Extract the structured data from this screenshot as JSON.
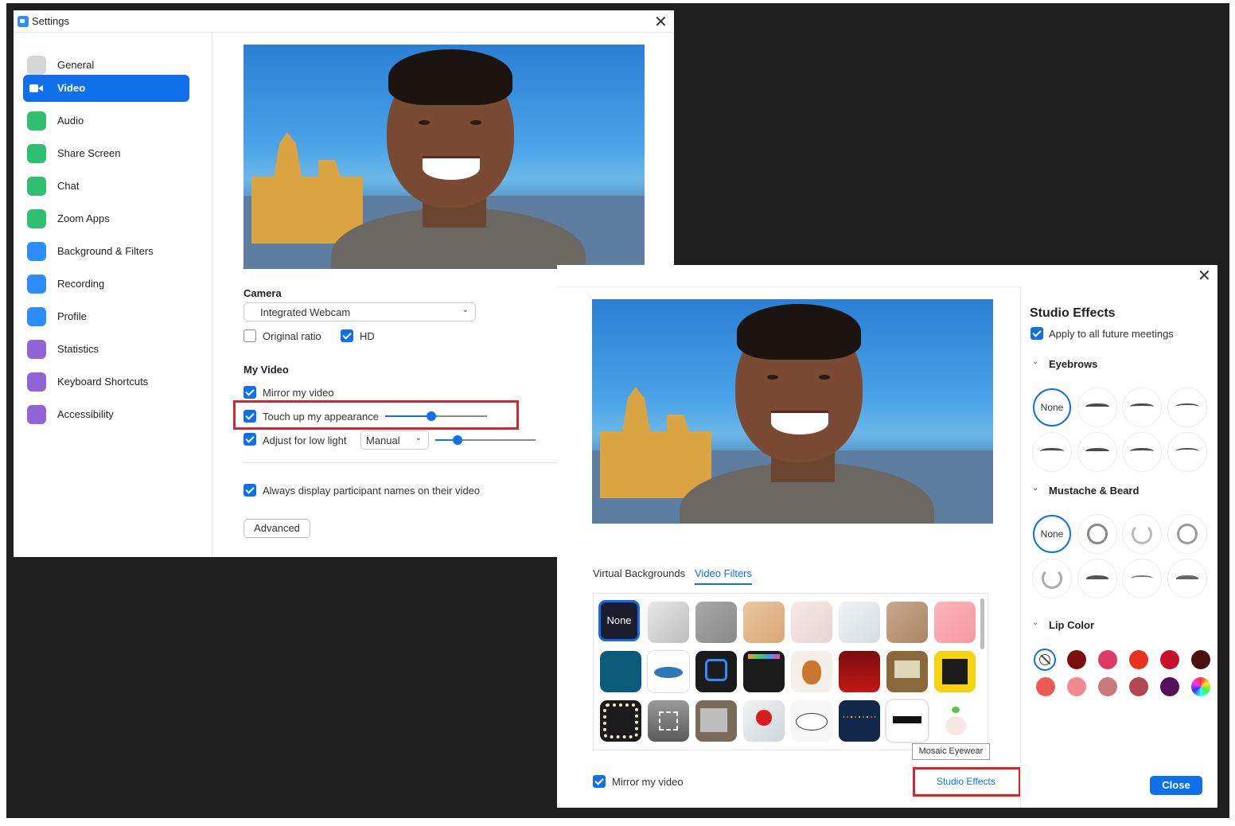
{
  "settings_window": {
    "title": "Settings",
    "close_glyph": "✕",
    "sidebar": [
      {
        "label": "General",
        "icon": "gear-icon",
        "color": "#b0b0b0"
      },
      {
        "label": "Video",
        "icon": "video-camera-icon",
        "color": "#ffffff",
        "active": true
      },
      {
        "label": "Audio",
        "icon": "headphones-icon",
        "color": "#2fbf71"
      },
      {
        "label": "Share Screen",
        "icon": "share-screen-icon",
        "color": "#2fbf71"
      },
      {
        "label": "Chat",
        "icon": "chat-icon",
        "color": "#2fbf71"
      },
      {
        "label": "Zoom Apps",
        "icon": "apps-icon",
        "color": "#2fbf71"
      },
      {
        "label": "Background & Filters",
        "icon": "background-icon",
        "color": "#2d8cff"
      },
      {
        "label": "Recording",
        "icon": "recording-icon",
        "color": "#2d8cff"
      },
      {
        "label": "Profile",
        "icon": "profile-icon",
        "color": "#2d8cff"
      },
      {
        "label": "Statistics",
        "icon": "statistics-icon",
        "color": "#8f65d8"
      },
      {
        "label": "Keyboard Shortcuts",
        "icon": "keyboard-icon",
        "color": "#8f65d8"
      },
      {
        "label": "Accessibility",
        "icon": "accessibility-icon",
        "color": "#8f65d8"
      }
    ],
    "camera": {
      "heading": "Camera",
      "selected": "Integrated Webcam",
      "original_ratio": "Original ratio",
      "original_ratio_checked": false,
      "hd": "HD",
      "hd_checked": true
    },
    "my_video": {
      "heading": "My Video",
      "mirror": "Mirror my video",
      "mirror_checked": true,
      "touch_up": "Touch up my appearance",
      "touch_up_checked": true,
      "touch_up_level": 0.45,
      "low_light": "Adjust for low light",
      "low_light_checked": true,
      "low_light_mode": "Manual",
      "low_light_level": 0.22,
      "participant_names": "Always display participant names on their video",
      "participant_names_checked": true,
      "advanced_button": "Advanced"
    }
  },
  "filters_window": {
    "close_glyph": "✕",
    "tabs": [
      "Virtual Backgrounds",
      "Video Filters"
    ],
    "active_tab": "Video Filters",
    "none_tile": "None",
    "tooltip": "Mosaic Eyewear",
    "mirror": "Mirror my video",
    "mirror_checked": true,
    "studio_effects_link": "Studio Effects"
  },
  "studio_effects": {
    "title": "Studio Effects",
    "apply_future": "Apply to all future meetings",
    "apply_future_checked": true,
    "eyebrows_heading": "Eyebrows",
    "mustache_heading": "Mustache & Beard",
    "lip_heading": "Lip Color",
    "none_label": "None",
    "lip_colors": [
      "#7d0e0e",
      "#e03a6a",
      "#e8311f",
      "#c8102e",
      "#4a1010",
      "#ee5a55",
      "#f08a8e",
      "#c97a7e",
      "#b2474f",
      "#56105a"
    ],
    "close_button": "Close"
  }
}
